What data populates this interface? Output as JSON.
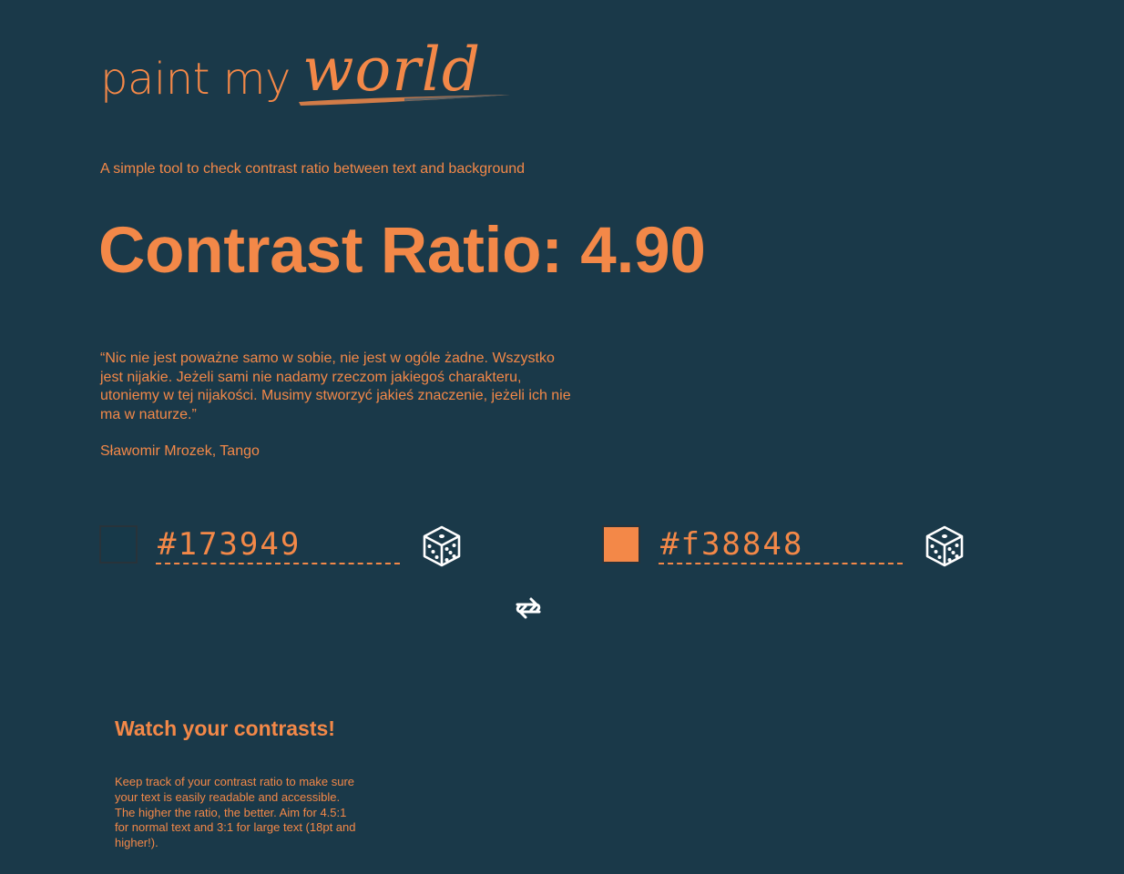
{
  "logo": {
    "plain_text": "paint my",
    "script_text": "world"
  },
  "subtitle": "A simple tool to check contrast ratio between text and background",
  "contrast": {
    "label": "Contrast Ratio: 4.90"
  },
  "quote": {
    "text": "“Nic nie jest poważne samo w sobie, nie jest w ogóle żadne. Wszystko jest nijakie. Jeżeli sami nie nadamy rzeczom jakiegoś charakteru, utoniemy w tej nijakości. Musimy stworzyć jakieś znaczenie, jeżeli ich nie ma w naturze.”",
    "author": "Sławomir Mrozek, Tango"
  },
  "background_color": {
    "value": "#173949",
    "swatch": "#173949",
    "icon": "dice-icon"
  },
  "text_color": {
    "value": "#f38848",
    "swatch": "#f38848",
    "icon": "dice-icon"
  },
  "swap": {
    "icon": "swap-arrows-icon"
  },
  "tip": {
    "title": "Watch your contrasts!",
    "body": "Keep track of your contrast ratio to make sure your text is easily readable and accessible. The higher the ratio, the better. Aim for 4.5:1 for normal text and 3:1 for large text (18pt and higher!)."
  },
  "colors": {
    "page_background": "#1a3949",
    "accent": "#f38848",
    "icon": "#ffffff"
  }
}
